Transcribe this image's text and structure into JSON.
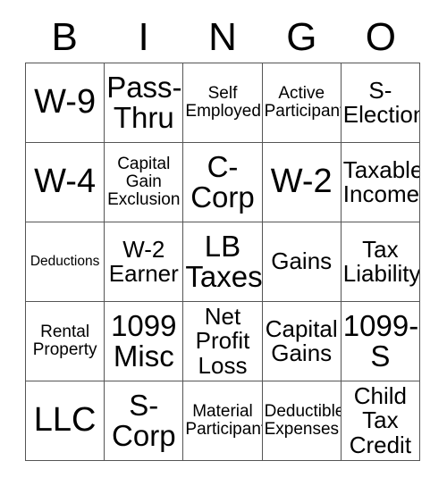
{
  "card": {
    "title_letters": [
      "B",
      "I",
      "N",
      "G",
      "O"
    ],
    "columns": 5,
    "rows": 5,
    "border_color": "#555555",
    "text_color": "#000000",
    "background_color": "#ffffff"
  },
  "cells": [
    {
      "text": "W-9",
      "size": "xl"
    },
    {
      "text": "Pass-\nThru",
      "size": "lg"
    },
    {
      "text": "Self\nEmployed",
      "size": "sm"
    },
    {
      "text": "Active\nParticipant",
      "size": "sm"
    },
    {
      "text": "S-\nElection",
      "size": "md"
    },
    {
      "text": "W-4",
      "size": "xl"
    },
    {
      "text": "Capital\nGain\nExclusion",
      "size": "sm"
    },
    {
      "text": "C-\nCorp",
      "size": "lg"
    },
    {
      "text": "W-2",
      "size": "xl"
    },
    {
      "text": "Taxable\nIncome",
      "size": "md"
    },
    {
      "text": "Deductions",
      "size": "xs"
    },
    {
      "text": "W-2\nEarner",
      "size": "md"
    },
    {
      "text": "LB\nTaxes",
      "size": "lg"
    },
    {
      "text": "Gains",
      "size": "md"
    },
    {
      "text": "Tax\nLiability",
      "size": "md"
    },
    {
      "text": "Rental\nProperty",
      "size": "sm"
    },
    {
      "text": "1099\nMisc",
      "size": "lg"
    },
    {
      "text": "Net\nProfit\nLoss",
      "size": "md"
    },
    {
      "text": "Capital\nGains",
      "size": "md"
    },
    {
      "text": "1099-\nS",
      "size": "lg"
    },
    {
      "text": "LLC",
      "size": "xl"
    },
    {
      "text": "S-\nCorp",
      "size": "lg"
    },
    {
      "text": "Material\nParticipant",
      "size": "sm"
    },
    {
      "text": "Deductible\nExpenses",
      "size": "sm"
    },
    {
      "text": "Child\nTax\nCredit",
      "size": "md"
    }
  ]
}
